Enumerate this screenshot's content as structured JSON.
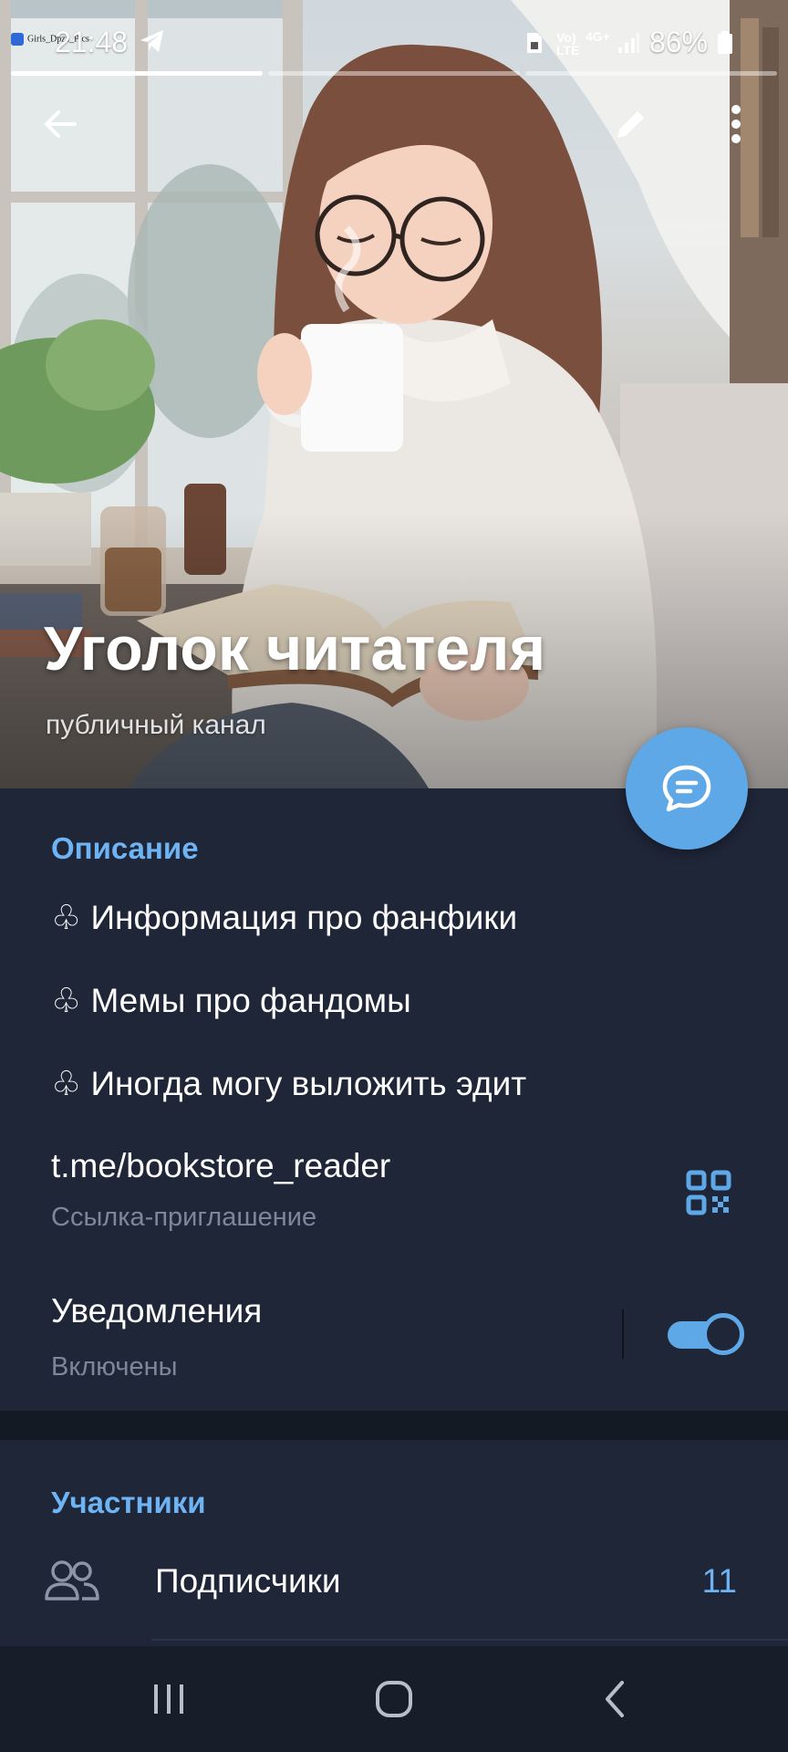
{
  "status_bar": {
    "time": "21:48",
    "network_top": "Vo)",
    "network_bottom": "LTE",
    "network_gen": "4G+",
    "battery": "86%",
    "story_account": "Girls_Dpzz_Pics"
  },
  "toolbar": {
    "back_icon": "arrow-left-icon",
    "edit_icon": "pencil-icon",
    "menu_icon": "more-vertical-icon"
  },
  "channel": {
    "title": "Уголок читателя",
    "subtitle": "публичный канал"
  },
  "description": {
    "label": "Описание",
    "lines": [
      "♧ Информация про фанфики",
      "♧ Мемы про фандомы",
      "♧ Иногда могу выложить эдит"
    ]
  },
  "invite_link": {
    "url": "t.me/bookstore_reader",
    "label": "Ссылка-приглашение",
    "icon": "qr-code-icon"
  },
  "notifications": {
    "title": "Уведомления",
    "state": "Включены",
    "enabled": true
  },
  "members": {
    "label": "Участники",
    "subscribers_label": "Подписчики",
    "subscribers_count": "11",
    "icon": "users-icon"
  },
  "fab_icon": "chat-bubble-icon",
  "colors": {
    "accent": "#5ea8e8",
    "panel_bg": "#1f2638",
    "section_label": "#6eb4f5",
    "secondary_text": "#7d8799"
  },
  "navbar": {
    "recents_icon": "recents-icon",
    "home_icon": "home-icon",
    "back_icon": "nav-back-icon"
  }
}
